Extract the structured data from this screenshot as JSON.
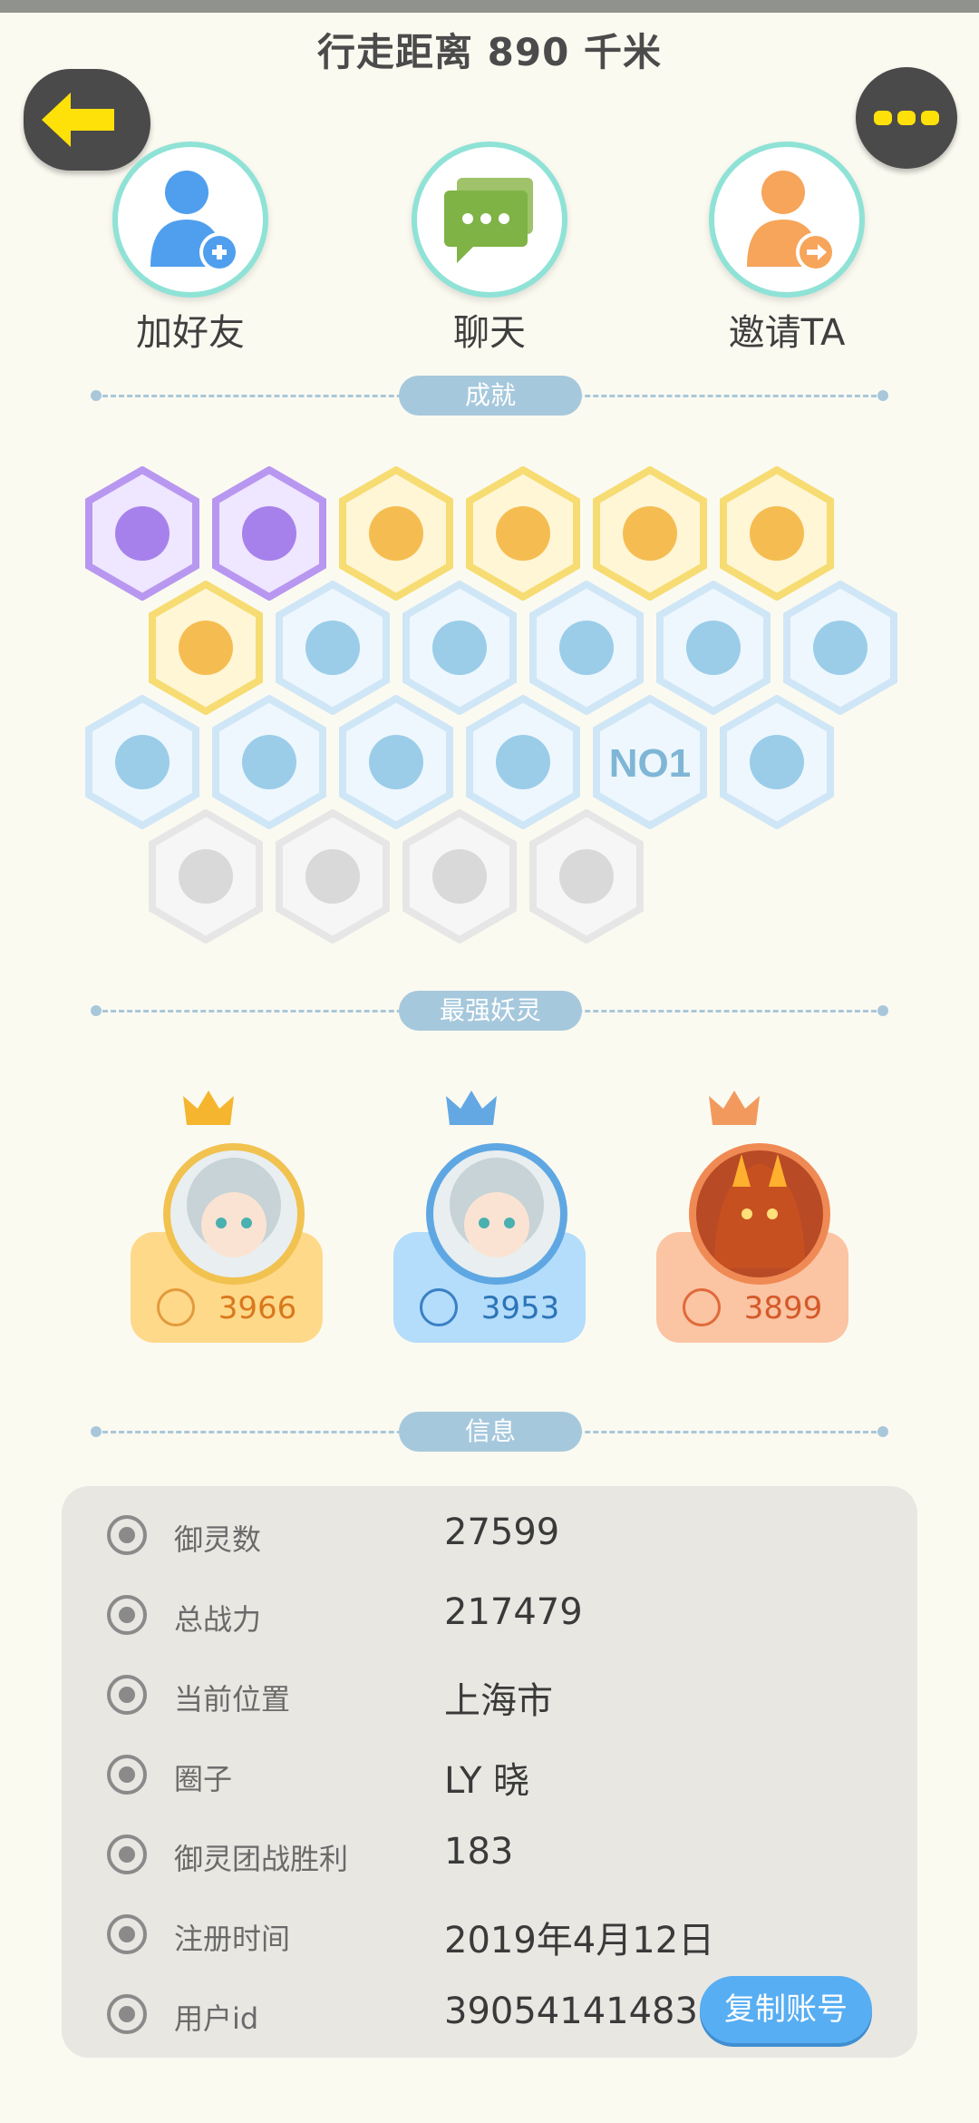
{
  "header": {
    "title": "行走距离 890 千米"
  },
  "actions": [
    {
      "label": "加好友",
      "icon": "add-friend-icon"
    },
    {
      "label": "聊天",
      "icon": "chat-icon"
    },
    {
      "label": "邀请TA",
      "icon": "invite-icon"
    }
  ],
  "sections": {
    "achievements": "成就",
    "strongest": "最强妖灵",
    "info": "信息"
  },
  "achievement_badges": {
    "badge_no1_text": "NO.1"
  },
  "spirits": [
    {
      "power": "3966",
      "theme": "#ffd98a",
      "accent": "#ea9b1c",
      "crown": "gold-crown-icon"
    },
    {
      "power": "3953",
      "theme": "#b4dcfb",
      "accent": "#2f7fc4",
      "crown": "blue-crown-icon"
    },
    {
      "power": "3899",
      "theme": "#fbc4a3",
      "accent": "#e0673a",
      "crown": "orange-crown-icon"
    }
  ],
  "info": {
    "rows": [
      {
        "label": "御灵数",
        "value": "27599"
      },
      {
        "label": "总战力",
        "value": "217479"
      },
      {
        "label": "当前位置",
        "value": "上海市"
      },
      {
        "label": "圈子",
        "value": "LY 晓"
      },
      {
        "label": "御灵团战胜利",
        "value": "183"
      },
      {
        "label": "注册时间",
        "value": "2019年4月12日"
      },
      {
        "label": "用户id",
        "value": "39054141483"
      }
    ],
    "copy_button": "复制账号"
  },
  "colors": {
    "background": "#fbfaf1",
    "accent_yellow": "#ffe10a",
    "pill": "#a6c8dc",
    "copy_button": "#58aef2"
  }
}
